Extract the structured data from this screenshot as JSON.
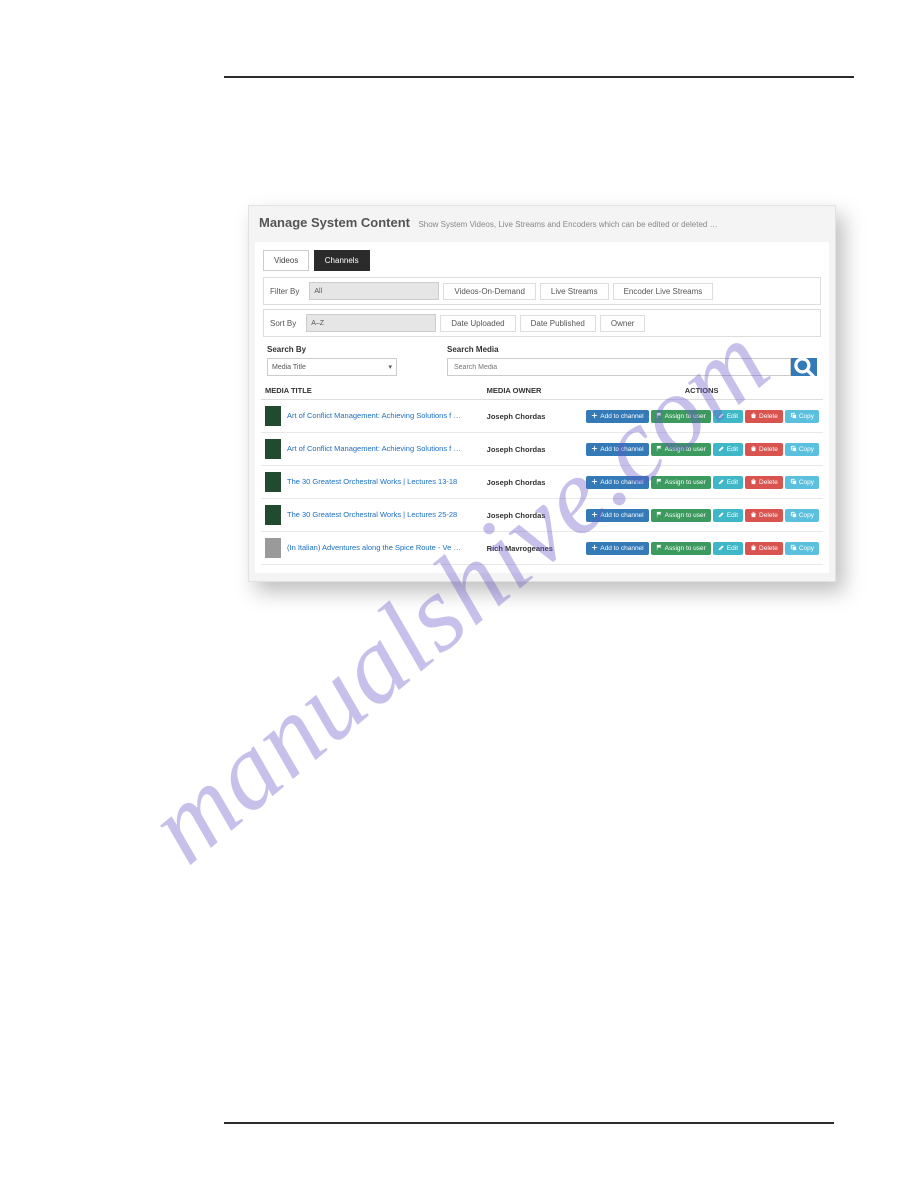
{
  "watermark": "manualshive.com",
  "panel": {
    "title": "Manage System Content",
    "subtitle": "Show System Videos, Live Streams and Encoders which can be edited or deleted …"
  },
  "tabs": {
    "videos": "Videos",
    "channels": "Channels"
  },
  "filter": {
    "label": "Filter By",
    "all": "All",
    "vod": "Videos-On-Demand",
    "live": "Live Streams",
    "enc": "Encoder Live Streams"
  },
  "sort": {
    "label": "Sort By",
    "az": "A–Z",
    "dateUp": "Date Uploaded",
    "datePub": "Date Published",
    "owner": "Owner"
  },
  "search": {
    "byLabel": "Search By",
    "mediaLabel": "Search Media",
    "selValue": "Media Title",
    "placeholder": "Search Media"
  },
  "colTitle": "MEDIA TITLE",
  "colOwner": "MEDIA OWNER",
  "colActions": "ACTIONS",
  "btns": {
    "add": "Add to channel",
    "assign": "Assign to user",
    "edit": "Edit",
    "delete": "Delete",
    "copy": "Copy"
  },
  "rows": [
    {
      "title": "Art of Conflict Management: Achieving Solutions f …",
      "owner": "Joseph Chordas"
    },
    {
      "title": "Art of Conflict Management: Achieving Solutions f …",
      "owner": "Joseph Chordas"
    },
    {
      "title": "The 30 Greatest Orchestral Works | Lectures 13-18",
      "owner": "Joseph Chordas"
    },
    {
      "title": "The 30 Greatest Orchestral Works | Lectures 25-28",
      "owner": "Joseph Chordas"
    },
    {
      "title": "(In Italian) Adventures along the Spice Route - Ve …",
      "owner": "Rich Mavrogeanes"
    }
  ]
}
